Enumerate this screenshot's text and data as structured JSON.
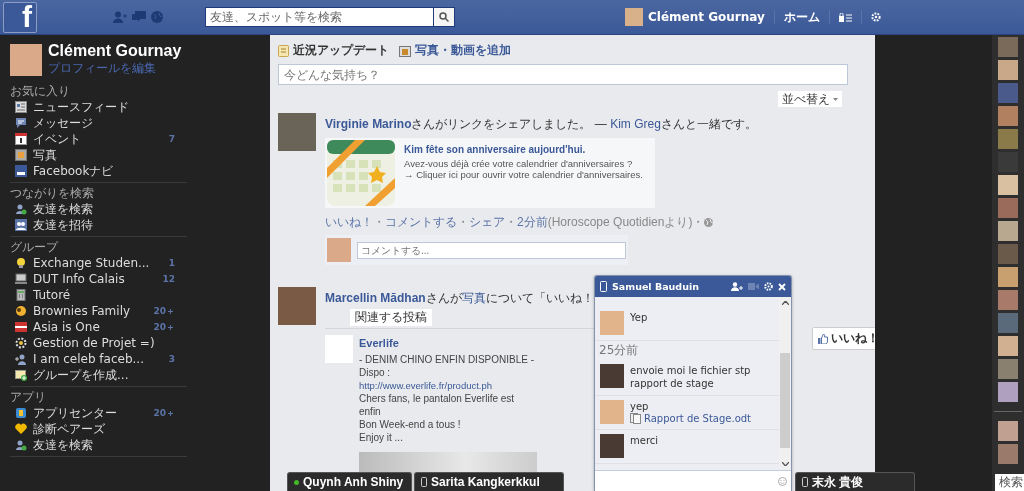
{
  "topbar": {
    "logo": "f",
    "search_placeholder": "友達、スポット等を検索",
    "user": "Clément Gournay",
    "home": "ホーム"
  },
  "sidebar": {
    "name": "Clément Gournay",
    "edit_profile": "プロフィールを編集",
    "sections": [
      {
        "title": "お気に入り",
        "items": [
          {
            "kind": "news",
            "label": "ニュースフィード"
          },
          {
            "kind": "message",
            "label": "メッセージ"
          },
          {
            "kind": "calendar",
            "label": "イベント",
            "count": "7"
          },
          {
            "kind": "photo",
            "label": "写真"
          },
          {
            "kind": "nav",
            "label": "Facebookナビ"
          }
        ]
      },
      {
        "title": "つながりを検索",
        "items": [
          {
            "kind": "friend-search",
            "label": "友達を検索"
          },
          {
            "kind": "friend-invite",
            "label": "友達を招待"
          }
        ]
      },
      {
        "title": "グループ",
        "items": [
          {
            "kind": "bulb",
            "label": "Exchange Studen...",
            "count": "1"
          },
          {
            "kind": "computer",
            "label": "DUT Info Calais",
            "count": "12"
          },
          {
            "kind": "calculator",
            "label": "Tutoré"
          },
          {
            "kind": "group",
            "label": "Brownies Family",
            "count": "20＋"
          },
          {
            "kind": "flag",
            "label": "Asia is One",
            "count": "20＋"
          },
          {
            "kind": "gear",
            "label": "Gestion de Projet =)"
          },
          {
            "kind": "person",
            "label": "I am celeb faceb...",
            "count": "3"
          },
          {
            "kind": "add-group",
            "label": "グループを作成..."
          }
        ]
      },
      {
        "title": "アプリ",
        "items": [
          {
            "kind": "app",
            "label": "アプリセンター",
            "count": "20＋"
          },
          {
            "kind": "heart",
            "label": "診断ペアーズ"
          },
          {
            "kind": "friend-search",
            "label": "友達を検索"
          }
        ]
      }
    ]
  },
  "composer": {
    "tabs": [
      {
        "label": "近況アップデート",
        "selected": true
      },
      {
        "label": "写真・動画を追加",
        "selected": false
      }
    ],
    "placeholder": "今どんな気持ち？"
  },
  "sort_button": "並べ替え",
  "posts": [
    {
      "kind": "link",
      "header": [
        {
          "kind": "author",
          "text": "Virginie Marino"
        },
        {
          "kind": "text",
          "text": "さんがリンクをシェアしました。 — "
        },
        {
          "kind": "link",
          "text": "Kim Greg"
        },
        {
          "kind": "text",
          "text": "さんと一緒です。"
        }
      ],
      "card": {
        "title": "Kim fête son anniversaire aujourd'hui.",
        "lines": [
          "Avez-vous déjà crée votre calendrier d'anniversaires ?",
          "→ Cliquer ici pour ouvrir votre calendrier d'anniversaires."
        ]
      },
      "footer": {
        "actions": [
          "いいね！",
          "コメントする",
          "シェア"
        ],
        "separator": "・",
        "time": "2分前",
        "source": "(Horoscope Quotidienより)"
      },
      "comment_placeholder": "コメントする..."
    },
    {
      "kind": "page",
      "header": [
        {
          "kind": "author",
          "text": "Marcellin Mādhan"
        },
        {
          "kind": "text",
          "text": "さんが"
        },
        {
          "kind": "link",
          "text": "写真"
        },
        {
          "kind": "text",
          "text": "について「いいね！"
        }
      ],
      "related_label": "関連する投稿",
      "page_name": "Everlife",
      "lines": [
        {
          "text": "- DENIM CHINO ENFIN DISPONIBLE -"
        },
        {
          "text": "Dispo : ",
          "link": "http://www.everlife.fr/product.ph"
        },
        {
          "text": "Chers fans, le pantalon Everlife est enfin"
        },
        {
          "text": "Bon Week-end a tous !"
        },
        {
          "text": "Enjoy it ..."
        }
      ],
      "like_button": "いいね！"
    }
  ],
  "chat": {
    "name": "Samuel Bauduin",
    "items": [
      {
        "kind": "message",
        "mine": true,
        "lines": [
          "Yep"
        ]
      },
      {
        "kind": "time",
        "text": "25分前"
      },
      {
        "kind": "message",
        "mine": false,
        "lines": [
          "envoie moi le fichier stp",
          "rapport de stage"
        ]
      },
      {
        "kind": "message",
        "mine": true,
        "lines": [
          "yep"
        ],
        "file": "Rapport de Stage.odt"
      },
      {
        "kind": "message",
        "mine": false,
        "lines": [
          "merci"
        ]
      }
    ]
  },
  "chat_tabs": [
    {
      "name": "Quynh Anh Shiny",
      "kind": "online"
    },
    {
      "name": "Sarita Kangkerkkul",
      "kind": "mobile"
    },
    {
      "name": "末永 貴俊",
      "kind": "mobile"
    }
  ],
  "right_column": {
    "search_label": "検索"
  }
}
